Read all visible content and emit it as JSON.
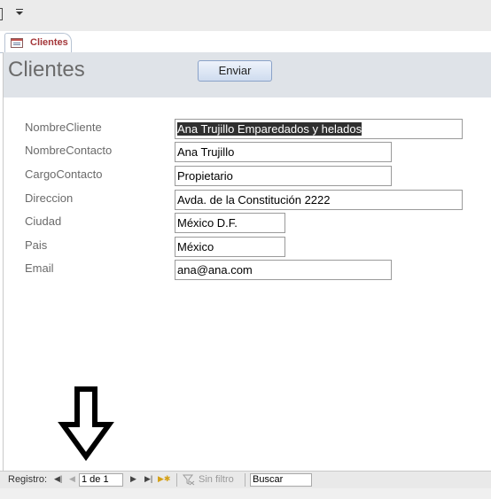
{
  "tab": {
    "label": "Clientes",
    "icon": "form-icon"
  },
  "form": {
    "title": "Clientes",
    "send_button": "Enviar",
    "fields": [
      {
        "label": "NombreCliente",
        "value": "Ana Trujillo Emparedados y helados"
      },
      {
        "label": "NombreContacto",
        "value": "Ana Trujillo"
      },
      {
        "label": "CargoContacto",
        "value": "Propietario"
      },
      {
        "label": "Direccion",
        "value": "Avda. de la Constitución 2222"
      },
      {
        "label": "Ciudad",
        "value": "México D.F."
      },
      {
        "label": "Pais",
        "value": "México"
      },
      {
        "label": "Email",
        "value": "ana@ana.com"
      }
    ]
  },
  "navigation": {
    "label": "Registro:",
    "record": "1 de 1",
    "filter": "Sin filtro",
    "search_placeholder": "Buscar"
  },
  "colors": {
    "tab_label": "#a4373a",
    "header_bg": "#dfe3e8",
    "selection": "#2f2f2f"
  }
}
